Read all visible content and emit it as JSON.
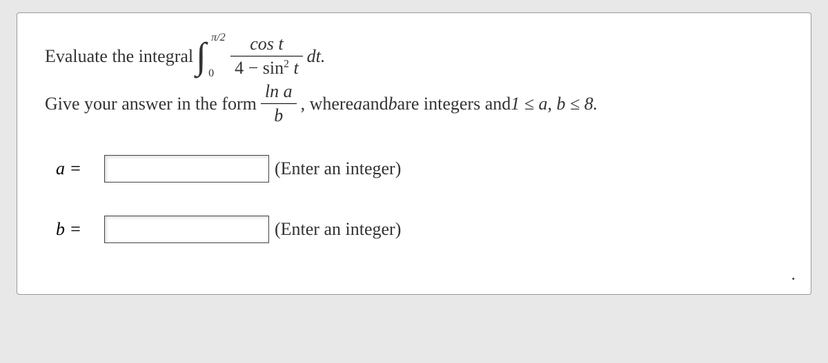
{
  "problem": {
    "line1_pre": "Evaluate the integral ",
    "integral_upper": "π/2",
    "integral_lower": "0",
    "frac1_num": "cos t",
    "frac1_den_left": "4 − sin",
    "frac1_den_exp": "2",
    "frac1_den_right": " t",
    "line1_post": "dt.",
    "line2_pre": "Give your answer in the form ",
    "frac2_num": "ln a",
    "frac2_den": "b",
    "line2_post_a": ", where ",
    "line2_post_b": " and ",
    "line2_post_c": " are integers and ",
    "line2_ineq": "1 ≤ a, b ≤ 8.",
    "var_a": "a",
    "var_b": "b"
  },
  "answers": {
    "a_label": "a =",
    "b_label": "b =",
    "a_value": "",
    "b_value": "",
    "hint": "(Enter an integer)"
  },
  "corner_mark": "."
}
